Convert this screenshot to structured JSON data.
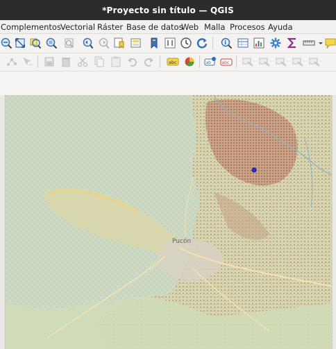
{
  "window": {
    "title": "*Proyecto sin título — QGIS"
  },
  "menu": {
    "items": [
      "Complementos",
      "Vectorial",
      "Ráster",
      "Base de datos",
      "Web",
      "Malla",
      "Procesos",
      "Ayuda"
    ]
  },
  "toolbar1": {
    "icons": [
      "zoom-out-icon",
      "zoom-full-icon",
      "zoom-to-selection-icon",
      "zoom-to-layer-icon",
      "zoom-native-icon",
      "zoom-last-icon",
      "zoom-next-icon",
      "new-bookmark-icon",
      "show-bookmarks-icon",
      "spatial-bookmark-icon",
      "temporal-controller-icon",
      "refresh-icon",
      "identify-icon",
      "attribute-table-icon",
      "statistics-icon",
      "settings-icon",
      "sum-icon",
      "measure-icon",
      "annotation-icon"
    ]
  },
  "toolbar2": {
    "icons": [
      "node-tool-icon",
      "move-feature-icon",
      "save-edits-icon",
      "delete-feature-icon",
      "cut-feature-icon",
      "copy-feature-icon",
      "paste-feature-icon",
      "undo-icon",
      "redo-icon",
      "label-abc-icon",
      "diagram-icon",
      "label-pin-icon",
      "label-rotate-icon",
      "label-change-icon",
      "label-show-icon",
      "label-move-icon",
      "label-move-2-icon",
      "label-rotate-2-icon"
    ]
  },
  "map": {
    "place_label": "Pucón"
  }
}
